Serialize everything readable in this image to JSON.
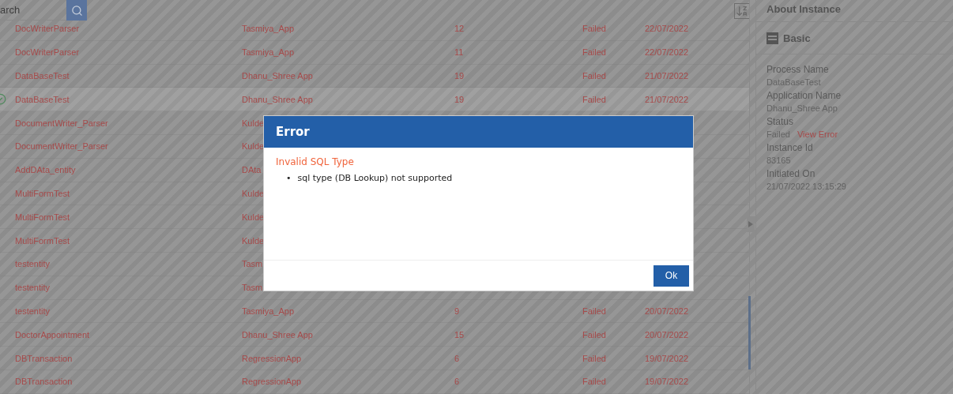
{
  "search": {
    "placeholder": "arch"
  },
  "rows": [
    {
      "name": "DocWriterParser",
      "app": "Tasmiya_App",
      "version": "12",
      "status": "Failed",
      "date": "22/07/2022",
      "selected": false
    },
    {
      "name": "DocWriterParser",
      "app": "Tasmiya_App",
      "version": "11",
      "status": "Failed",
      "date": "22/07/2022",
      "selected": false
    },
    {
      "name": "DataBaseTest",
      "app": "Dhanu_Shree App",
      "version": "19",
      "status": "Failed",
      "date": "21/07/2022",
      "selected": false
    },
    {
      "name": "DataBaseTest",
      "app": "Dhanu_Shree App",
      "version": "19",
      "status": "Failed",
      "date": "21/07/2022",
      "selected": true
    },
    {
      "name": "DocumentWriter_Parser",
      "app": "Kulde",
      "selected": false
    },
    {
      "name": "DocumentWriter_Parser",
      "app": "Kulde",
      "selected": false
    },
    {
      "name": "AddDAta_entity",
      "app": "DAta",
      "selected": false
    },
    {
      "name": "MultiFormTest",
      "app": "Kulde",
      "selected": false
    },
    {
      "name": "MultiFormTest",
      "app": "Kulde",
      "selected": false
    },
    {
      "name": "MultiFormTest",
      "app": "Kulde",
      "selected": false
    },
    {
      "name": "testentity",
      "app": "Tasm",
      "selected": false
    },
    {
      "name": "testentity",
      "app": "Tasm",
      "selected": false
    },
    {
      "name": "testentity",
      "app": "Tasmiya_App",
      "version": "9",
      "status": "Failed",
      "date": "20/07/2022",
      "selected": false
    },
    {
      "name": "DoctorAppointment",
      "app": "Dhanu_Shree App",
      "version": "15",
      "status": "Failed",
      "date": "20/07/2022",
      "selected": false
    },
    {
      "name": "DBTransaction",
      "app": "RegressionApp",
      "version": "6",
      "status": "Failed",
      "date": "19/07/2022",
      "selected": false
    },
    {
      "name": "DBTransaction",
      "app": "RegressionApp",
      "version": "6",
      "status": "Failed",
      "date": "19/07/2022",
      "selected": false
    }
  ],
  "panel": {
    "title": "About Instance",
    "section": "Basic",
    "fields": [
      {
        "label": "Process Name",
        "value": "DataBaseTest"
      },
      {
        "label": "Application Name",
        "value": "Dhanu_Shree App"
      },
      {
        "label": "Status",
        "value": "Failed",
        "link": "View Error"
      },
      {
        "label": "Instance Id",
        "value": "83165"
      },
      {
        "label": "Initiated On",
        "value": "21/07/2022 13:15:29"
      }
    ]
  },
  "dialog": {
    "title": "Error",
    "message": "Invalid SQL Type",
    "details": [
      {
        "marker": "•",
        "text": "sql type (DB Lookup) not supported"
      }
    ],
    "button": "Ok"
  }
}
